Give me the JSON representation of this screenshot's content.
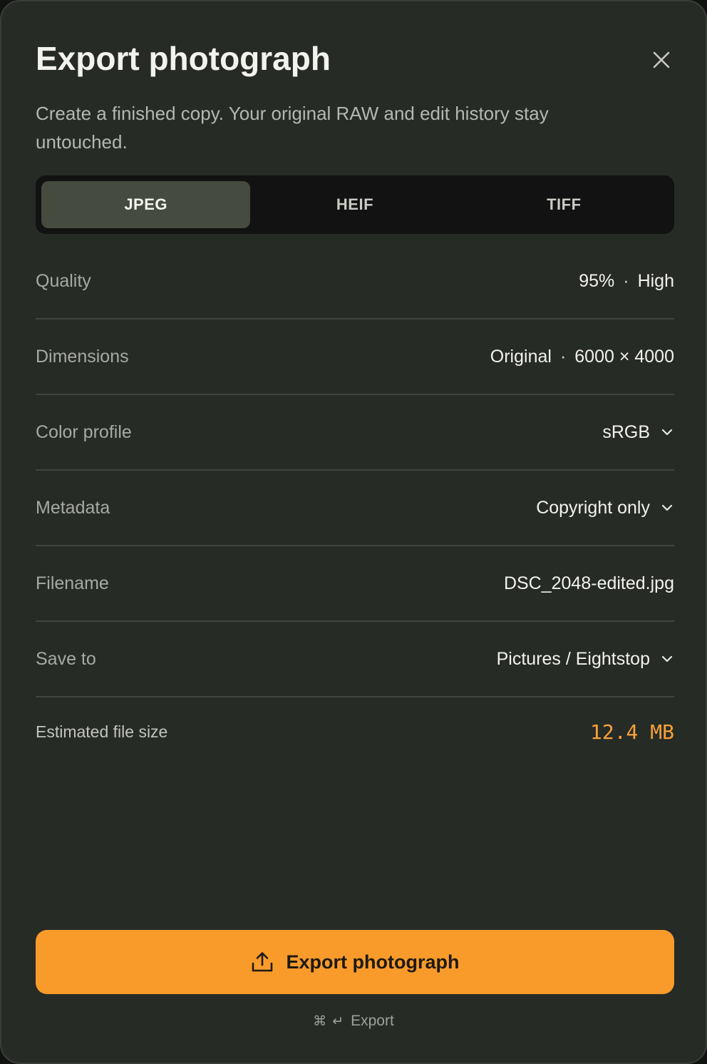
{
  "dialog": {
    "title": "Export photograph",
    "subtitle": "Create a finished copy. Your original RAW and edit history stay untouched.",
    "close_icon": "close-icon"
  },
  "formats": {
    "selected": "JPEG",
    "options": [
      {
        "label": "JPEG",
        "active": true
      },
      {
        "label": "HEIF",
        "active": false
      },
      {
        "label": "TIFF",
        "active": false
      }
    ]
  },
  "settings": {
    "quality": {
      "label": "Quality",
      "value": "95%",
      "sep": "·",
      "detail": "High"
    },
    "dimensions": {
      "label": "Dimensions",
      "value": "Original",
      "sep": "·",
      "detail": "6000 × 4000"
    },
    "color_profile": {
      "label": "Color profile",
      "value": "sRGB",
      "icon": "chevron-down-icon"
    },
    "metadata": {
      "label": "Metadata",
      "value": "Copyright only",
      "icon": "chevron-down-icon"
    },
    "filename": {
      "label": "Filename",
      "value": "DSC_2048-edited.jpg"
    },
    "save_to": {
      "label": "Save to",
      "value": "Pictures / Eightstop",
      "icon": "chevron-down-icon"
    }
  },
  "estimate": {
    "label": "Estimated file size",
    "value": "12.4 MB"
  },
  "actions": {
    "export_label": "Export photograph",
    "export_icon": "upload-icon",
    "shortcut_cmd": "⌘",
    "shortcut_enter": "↵",
    "shortcut_label": "Export"
  },
  "colors": {
    "background": "#272b26",
    "accent": "#f99b2b",
    "accent_text": "#f7a23a",
    "segment_active": "#464b3f"
  }
}
